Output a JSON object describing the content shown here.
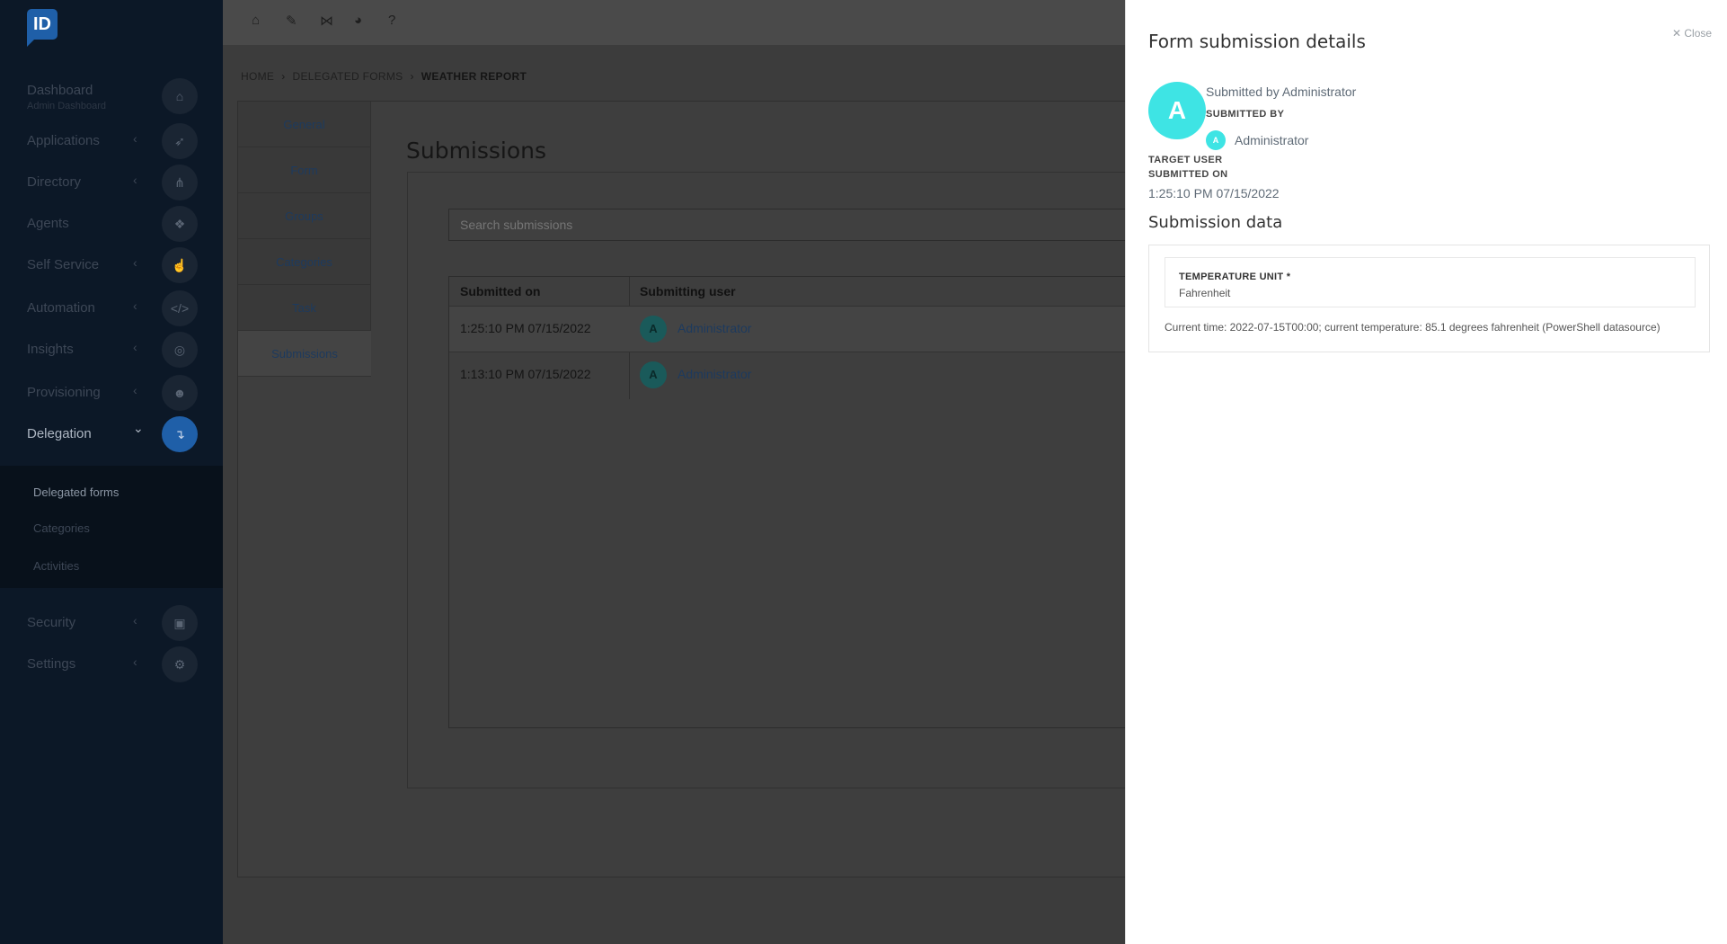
{
  "logo": "ID",
  "sidebar": {
    "items": [
      {
        "label": "Dashboard",
        "sublabel": "Admin Dashboard",
        "icon": "home-icon",
        "chevron": ""
      },
      {
        "label": "Applications",
        "sublabel": "",
        "icon": "rocket-icon",
        "chevron": "‹"
      },
      {
        "label": "Directory",
        "sublabel": "",
        "icon": "sitemap-icon",
        "chevron": "‹"
      },
      {
        "label": "Agents",
        "sublabel": "",
        "icon": "cubes-icon",
        "chevron": ""
      },
      {
        "label": "Self Service",
        "sublabel": "",
        "icon": "hand-pointer-icon",
        "chevron": "‹"
      },
      {
        "label": "Automation",
        "sublabel": "",
        "icon": "code-icon",
        "chevron": "‹"
      },
      {
        "label": "Insights",
        "sublabel": "",
        "icon": "lightbulb-icon",
        "chevron": "‹"
      },
      {
        "label": "Provisioning",
        "sublabel": "",
        "icon": "users-icon",
        "chevron": "‹"
      },
      {
        "label": "Delegation",
        "sublabel": "",
        "icon": "delegation-icon",
        "chevron": "⌄"
      },
      {
        "label": "Security",
        "sublabel": "",
        "icon": "lock-icon",
        "chevron": "‹"
      },
      {
        "label": "Settings",
        "sublabel": "",
        "icon": "gear-icon",
        "chevron": "‹"
      }
    ],
    "subitems": [
      "Delegated forms",
      "Categories",
      "Activities"
    ]
  },
  "breadcrumb": {
    "home": "HOME",
    "parent": "DELEGATED FORMS",
    "current": "WEATHER REPORT"
  },
  "tabs": [
    "General",
    "Form",
    "Groups",
    "Categories",
    "Task",
    "Submissions"
  ],
  "main": {
    "title": "Submissions",
    "search_placeholder": "Search submissions",
    "columns": [
      "Submitted on",
      "Submitting user"
    ],
    "rows": [
      {
        "date": "1:25:10 PM 07/15/2022",
        "avatar": "A",
        "user": "Administrator"
      },
      {
        "date": "1:13:10 PM 07/15/2022",
        "avatar": "A",
        "user": "Administrator"
      }
    ]
  },
  "details": {
    "close": "✕ Close",
    "title": "Form submission details",
    "avatar": "A",
    "submitted_by_text": "Submitted by Administrator",
    "submitted_by_label": "SUBMITTED BY",
    "submitted_by_avatar": "A",
    "submitted_by_name": "Administrator",
    "target_user_label": "TARGET USER",
    "submitted_on_label": "SUBMITTED ON",
    "submitted_on": "1:25:10 PM 07/15/2022",
    "section_title": "Submission data",
    "field_label": "TEMPERATURE UNIT *",
    "field_value": "Fahrenheit",
    "description": "Current time: 2022-07-15T00:00; current temperature: 85.1 degrees fahrenheit (PowerShell datasource)"
  },
  "colors": {
    "accent": "#1f5fa8",
    "avatar": "#3ee4e4",
    "sidebar": "#0c1827"
  }
}
